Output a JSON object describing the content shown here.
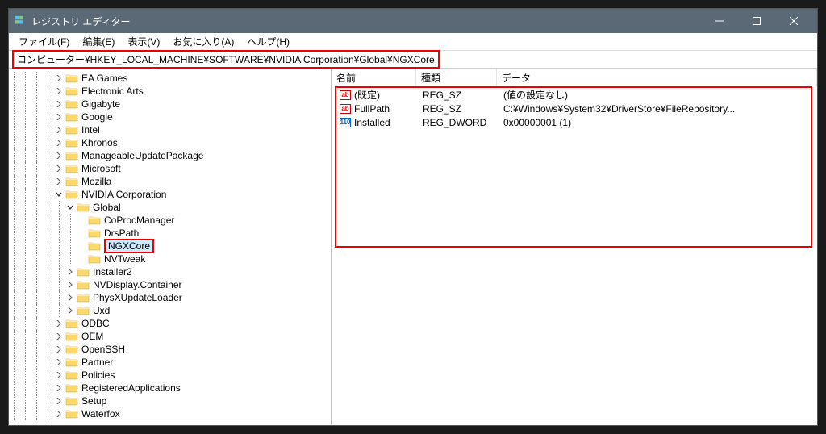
{
  "title": "レジストリ エディター",
  "menu": {
    "file": "ファイル(F)",
    "edit": "編集(E)",
    "view": "表示(V)",
    "favorites": "お気に入り(A)",
    "help": "ヘルプ(H)"
  },
  "address": "コンピューター¥HKEY_LOCAL_MACHINE¥SOFTWARE¥NVIDIA Corporation¥Global¥NGXCore",
  "tree": [
    {
      "indent": 4,
      "exp": "closed",
      "label": "EA Games"
    },
    {
      "indent": 4,
      "exp": "closed",
      "label": "Electronic Arts"
    },
    {
      "indent": 4,
      "exp": "closed",
      "label": "Gigabyte"
    },
    {
      "indent": 4,
      "exp": "closed",
      "label": "Google"
    },
    {
      "indent": 4,
      "exp": "closed",
      "label": "Intel"
    },
    {
      "indent": 4,
      "exp": "closed",
      "label": "Khronos"
    },
    {
      "indent": 4,
      "exp": "closed",
      "label": "ManageableUpdatePackage"
    },
    {
      "indent": 4,
      "exp": "closed",
      "label": "Microsoft"
    },
    {
      "indent": 4,
      "exp": "closed",
      "label": "Mozilla"
    },
    {
      "indent": 4,
      "exp": "open",
      "label": "NVIDIA Corporation"
    },
    {
      "indent": 5,
      "exp": "open",
      "label": "Global"
    },
    {
      "indent": 6,
      "exp": "none",
      "label": "CoProcManager"
    },
    {
      "indent": 6,
      "exp": "none",
      "label": "DrsPath"
    },
    {
      "indent": 6,
      "exp": "none",
      "label": "NGXCore",
      "selected": true
    },
    {
      "indent": 6,
      "exp": "none",
      "label": "NVTweak"
    },
    {
      "indent": 5,
      "exp": "closed",
      "label": "Installer2"
    },
    {
      "indent": 5,
      "exp": "closed",
      "label": "NVDisplay.Container"
    },
    {
      "indent": 5,
      "exp": "closed",
      "label": "PhysXUpdateLoader"
    },
    {
      "indent": 5,
      "exp": "closed",
      "label": "Uxd"
    },
    {
      "indent": 4,
      "exp": "closed",
      "label": "ODBC"
    },
    {
      "indent": 4,
      "exp": "closed",
      "label": "OEM"
    },
    {
      "indent": 4,
      "exp": "closed",
      "label": "OpenSSH"
    },
    {
      "indent": 4,
      "exp": "closed",
      "label": "Partner"
    },
    {
      "indent": 4,
      "exp": "closed",
      "label": "Policies"
    },
    {
      "indent": 4,
      "exp": "closed",
      "label": "RegisteredApplications"
    },
    {
      "indent": 4,
      "exp": "closed",
      "label": "Setup"
    },
    {
      "indent": 4,
      "exp": "closed",
      "label": "Waterfox"
    }
  ],
  "columns": {
    "name": "名前",
    "type": "種類",
    "data": "データ"
  },
  "values": [
    {
      "icon": "sz",
      "name": "(既定)",
      "type": "REG_SZ",
      "data": "(値の設定なし)"
    },
    {
      "icon": "sz",
      "name": "FullPath",
      "type": "REG_SZ",
      "data": "C:¥Windows¥System32¥DriverStore¥FileRepository..."
    },
    {
      "icon": "dw",
      "name": "Installed",
      "type": "REG_DWORD",
      "data": "0x00000001 (1)"
    }
  ]
}
